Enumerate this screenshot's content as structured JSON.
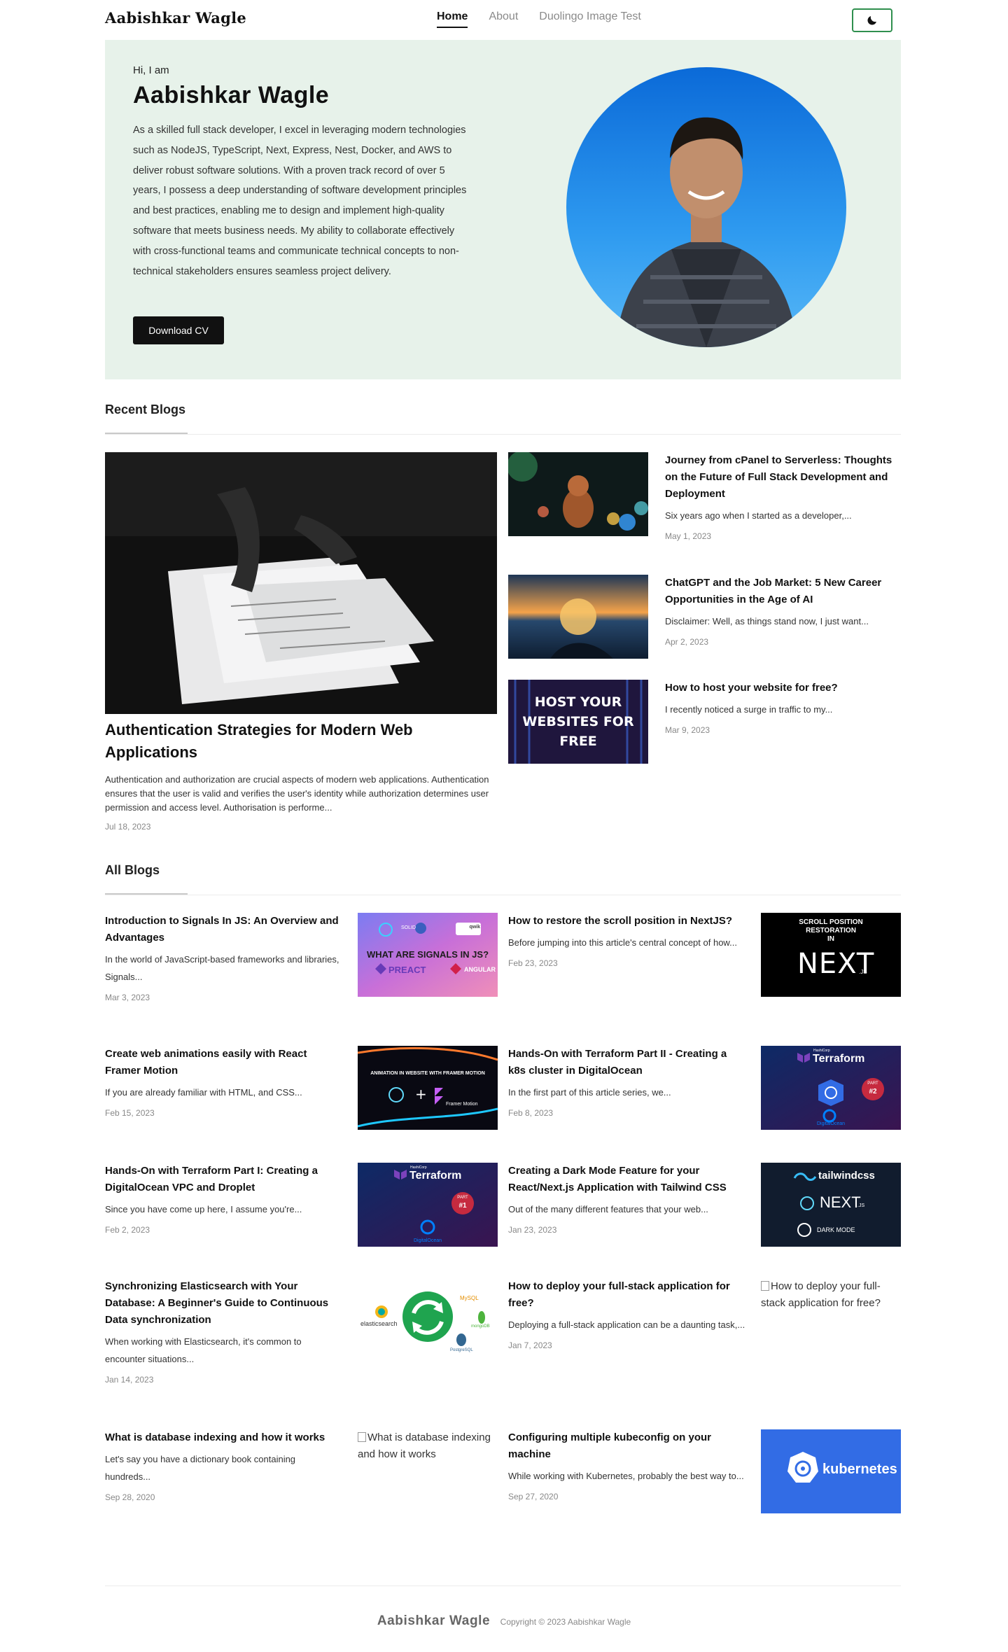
{
  "header": {
    "brand": "Aabishkar Wagle",
    "nav": [
      "Home",
      "About",
      "Duolingo Image Test"
    ],
    "theme_icon": "moon-icon"
  },
  "hero": {
    "greeting": "Hi, I am",
    "name": "Aabishkar Wagle",
    "description": "As a skilled full stack developer, I excel in leveraging modern technologies such as NodeJS, TypeScript, Next, Express, Nest, Docker, and AWS to deliver robust software solutions. With a proven track record of over 5 years, I possess a deep understanding of software development principles and best practices, enabling me to design and implement high-quality software that meets business needs. My ability to collaborate effectively with cross-functional teams and communicate technical concepts to non-technical stakeholders ensures seamless project delivery.",
    "cta": "Download CV"
  },
  "recent": {
    "heading": "Recent Blogs",
    "featured": {
      "title": "Authentication Strategies for Modern Web Applications",
      "excerpt": "Authentication and authorization are crucial aspects of modern web applications. Authentication ensures that the user is valid and verifies the user's identity while authorization determines user permission and access level. Authorisation is performe...",
      "date": "Jul 18, 2023"
    },
    "items": [
      {
        "title": "Journey from cPanel to Serverless: Thoughts on the Future of Full Stack Development and Deployment",
        "excerpt": "Six years ago when I started as a developer,...",
        "date": "May 1, 2023"
      },
      {
        "title": "ChatGPT and the Job Market: 5 New Career Opportunities in the Age of AI",
        "excerpt": "Disclaimer: Well, as things stand now, I just want...",
        "date": "Apr 2, 2023"
      },
      {
        "title": "How to host your website for free?",
        "excerpt": "I recently noticed a surge in traffic to my...",
        "date": "Mar 9, 2023",
        "image_text": [
          "HOST YOUR",
          "WEBSITES FOR",
          "FREE"
        ]
      }
    ]
  },
  "all": {
    "heading": "All Blogs",
    "items": [
      {
        "title": "Introduction to Signals In JS: An Overview and Advantages",
        "excerpt": "In the world of JavaScript-based frameworks and libraries, Signals...",
        "date": "Mar 3, 2023",
        "image_text": [
          "WHAT ARE SIGNALS IN JS?",
          "SOLID",
          "qwik",
          "PREACT",
          "ANGULAR"
        ]
      },
      {
        "title": "How to restore the scroll position in NextJS?",
        "excerpt": "Before jumping into this article's central concept of how...",
        "date": "Feb 23, 2023",
        "image_text": [
          "SCROLL POSITION",
          "RESTORATION",
          "IN",
          "NEXT",
          ".JS"
        ]
      },
      {
        "title": "Create web animations easily with React Framer Motion",
        "excerpt": "If you are already familiar with HTML, and CSS...",
        "date": "Feb 15, 2023",
        "image_text": [
          "ANIMATION IN WEBSITE WITH FRAMER MOTION",
          "Framer Motion"
        ]
      },
      {
        "title": "Hands-On with Terraform Part II - Creating a k8s cluster in DigitalOcean",
        "excerpt": "In the first part of this article series, we...",
        "date": "Feb 8, 2023",
        "image_text": [
          "HashiCorp",
          "Terraform",
          "PART",
          "#2",
          "DigitalOcean"
        ]
      },
      {
        "title": "Hands-On with Terraform Part I: Creating a DigitalOcean VPC and Droplet",
        "excerpt": "Since you have come up here, I assume you're...",
        "date": "Feb 2, 2023",
        "image_text": [
          "HashiCorp",
          "Terraform",
          "PART",
          "#1",
          "DigitalOcean"
        ]
      },
      {
        "title": "Creating a Dark Mode Feature for your React/Next.js Application with Tailwind CSS",
        "excerpt": "Out of the many different features that your web...",
        "date": "Jan 23, 2023",
        "image_text": [
          "tailwindcss",
          "NEXT",
          ".JS",
          "DARK MODE"
        ]
      },
      {
        "title": "Synchronizing Elasticsearch with Your Database: A Beginner's Guide to Continuous Data synchronization",
        "excerpt": "When working with Elasticsearch, it's common to encounter situations...",
        "date": "Jan 14, 2023",
        "image_text": [
          "elasticsearch",
          "MySQL",
          "mongoDB",
          "PostgreSQL"
        ]
      },
      {
        "title": "How to deploy your full-stack application for free?",
        "excerpt": "Deploying a full-stack application can be a daunting task,...",
        "date": "Jan 7, 2023",
        "image_alt": "How to deploy your full-stack application for free?"
      },
      {
        "title": "What is database indexing and how it works",
        "excerpt": "Let's say you have a dictionary book containing hundreds...",
        "date": "Sep 28, 2020",
        "image_alt": "What is database indexing and how it works"
      },
      {
        "title": "Configuring multiple kubeconfig on your machine",
        "excerpt": "While working with Kubernetes, probably the best way to...",
        "date": "Sep 27, 2020",
        "image_text": [
          "kubernetes"
        ]
      }
    ]
  },
  "footer": {
    "name": "Aabishkar Wagle",
    "copyright": "Copyright © 2023 Aabishkar Wagle"
  }
}
